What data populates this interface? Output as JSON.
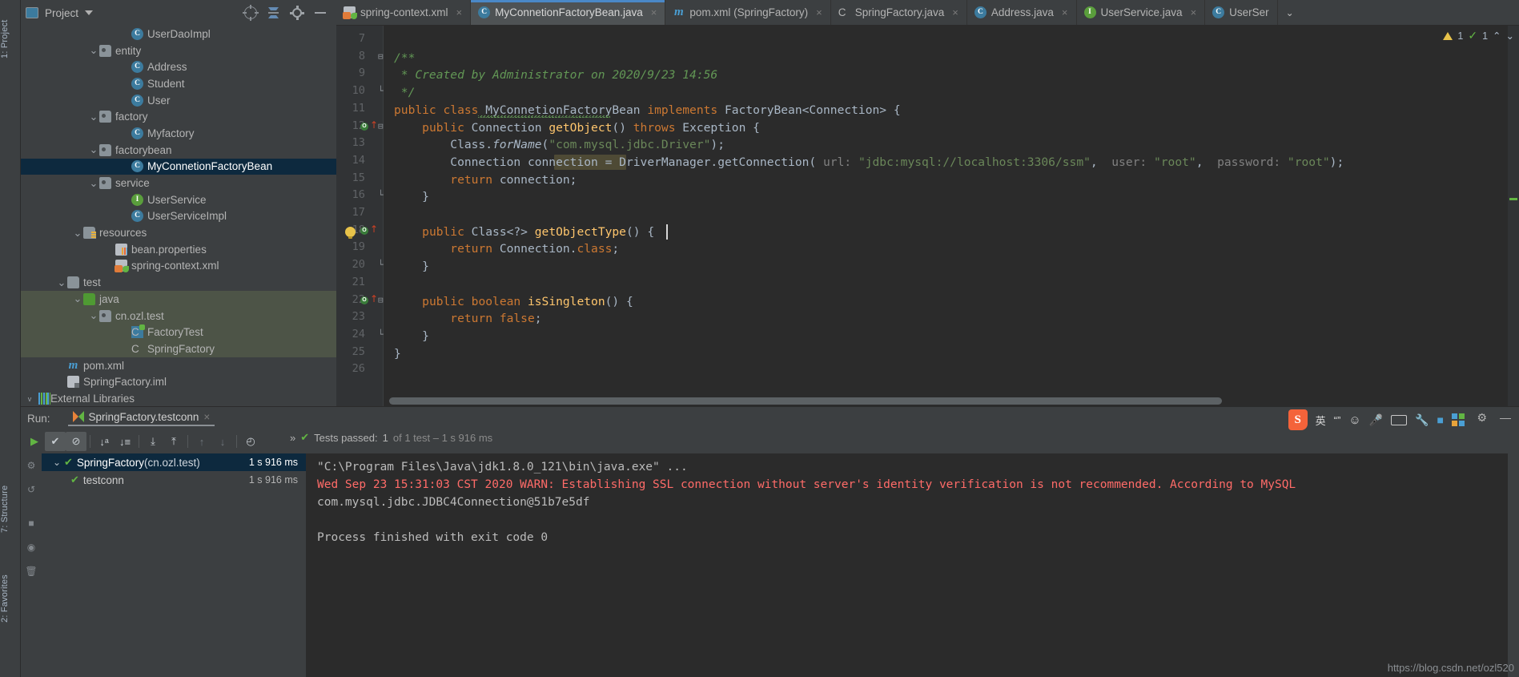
{
  "window": {
    "left_vertical_tabs": [
      {
        "label": "1: Project",
        "name": "project"
      },
      {
        "label": "7: Structure",
        "name": "structure"
      },
      {
        "label": "2: Favorites",
        "name": "favorites"
      }
    ]
  },
  "project_panel": {
    "title": "Project",
    "caret": "chevron-down",
    "tools": [
      "locate-icon",
      "collapse-all-icon",
      "settings-gear-icon",
      "hide-icon"
    ]
  },
  "tabs": [
    {
      "label": "spring-context.xml",
      "icon": "xml",
      "active": false,
      "close": "×"
    },
    {
      "label": "MyConnetionFactoryBean.java",
      "icon": "cls",
      "active": true,
      "close": "×"
    },
    {
      "label": "pom.xml (SpringFactory)",
      "icon": "m",
      "active": false,
      "close": "×"
    },
    {
      "label": "SpringFactory.java",
      "icon": "cls-run",
      "active": false,
      "close": "×"
    },
    {
      "label": "Address.java",
      "icon": "cls",
      "active": false,
      "close": "×"
    },
    {
      "label": "UserService.java",
      "icon": "iface",
      "active": false,
      "close": "×"
    },
    {
      "label": "UserSer",
      "icon": "cls",
      "active": false,
      "close": ""
    }
  ],
  "tabs_overflow_caret": "⌄",
  "inspection": {
    "warning_count": "1",
    "inspection_count": "1",
    "up_caret": "⌃",
    "down_caret": "⌄"
  },
  "tree": [
    {
      "label": "UserDaoImpl",
      "icon": "cls",
      "indent": 6,
      "arrow": "",
      "state": ""
    },
    {
      "label": "entity",
      "icon": "folder-pkg",
      "indent": 4,
      "arrow": "v",
      "state": ""
    },
    {
      "label": "Address",
      "icon": "cls",
      "indent": 6,
      "arrow": "",
      "state": ""
    },
    {
      "label": "Student",
      "icon": "cls",
      "indent": 6,
      "arrow": "",
      "state": ""
    },
    {
      "label": "User",
      "icon": "cls",
      "indent": 6,
      "arrow": "",
      "state": ""
    },
    {
      "label": "factory",
      "icon": "folder-pkg",
      "indent": 4,
      "arrow": "v",
      "state": ""
    },
    {
      "label": "Myfactory",
      "icon": "cls",
      "indent": 6,
      "arrow": "",
      "state": ""
    },
    {
      "label": "factorybean",
      "icon": "folder-pkg",
      "indent": 4,
      "arrow": "v",
      "state": ""
    },
    {
      "label": "MyConnetionFactoryBean",
      "icon": "cls",
      "indent": 6,
      "arrow": "",
      "state": "sel"
    },
    {
      "label": "service",
      "icon": "folder-pkg",
      "indent": 4,
      "arrow": "v",
      "state": ""
    },
    {
      "label": "UserService",
      "icon": "iface",
      "indent": 6,
      "arrow": "",
      "state": ""
    },
    {
      "label": "UserServiceImpl",
      "icon": "cls",
      "indent": 6,
      "arrow": "",
      "state": ""
    },
    {
      "label": "resources",
      "icon": "folder-res",
      "indent": 3,
      "arrow": "v",
      "state": ""
    },
    {
      "label": "bean.properties",
      "icon": "props",
      "indent": 5,
      "arrow": "",
      "state": ""
    },
    {
      "label": "spring-context.xml",
      "icon": "xml",
      "indent": 5,
      "arrow": "",
      "state": ""
    },
    {
      "label": "test",
      "icon": "folder",
      "indent": 2,
      "arrow": "v",
      "state": ""
    },
    {
      "label": "java",
      "icon": "folder-green",
      "indent": 3,
      "arrow": "v",
      "state": "testsrc"
    },
    {
      "label": "cn.ozl.test",
      "icon": "folder-pkg",
      "indent": 4,
      "arrow": "v",
      "state": "testsrc"
    },
    {
      "label": "FactoryTest",
      "icon": "cls-test",
      "indent": 6,
      "arrow": "",
      "state": "testsrc"
    },
    {
      "label": "SpringFactory",
      "icon": "cls-run",
      "indent": 6,
      "arrow": "",
      "state": "testsrc"
    },
    {
      "label": "pom.xml",
      "icon": "m",
      "indent": 2,
      "arrow": "",
      "state": ""
    },
    {
      "label": "SpringFactory.iml",
      "icon": "iml",
      "indent": 2,
      "arrow": "",
      "state": ""
    }
  ],
  "external_libraries": {
    "label": "External Libraries",
    "arrow": "v",
    "icon": "lib"
  },
  "editor": {
    "first_line_number": 7,
    "last_line_number": 26,
    "lines": [
      {
        "n": 7,
        "segments": []
      },
      {
        "n": 8,
        "segments": [
          {
            "t": "/**",
            "c": "cmt"
          }
        ],
        "indent": 0,
        "fold": "minus"
      },
      {
        "n": 9,
        "segments": [
          {
            "t": " * Created by Administrator on 2020/9/23 14:56",
            "c": "cmt"
          }
        ],
        "indent": 0
      },
      {
        "n": 10,
        "segments": [
          {
            "t": " */",
            "c": "cmt"
          }
        ],
        "indent": 0,
        "fold": "end"
      },
      {
        "n": 11,
        "segments": [
          {
            "t": "public ",
            "c": "kw"
          },
          {
            "t": "class ",
            "c": "kw"
          },
          {
            "t": "MyConnetionFactoryBean ",
            "c": "plain"
          },
          {
            "t": "implements ",
            "c": "kw"
          },
          {
            "t": "FactoryBean<Connection> {",
            "c": "plain"
          }
        ]
      },
      {
        "n": 12,
        "segments": [
          {
            "t": "    ",
            "c": "plain"
          },
          {
            "t": "public ",
            "c": "kw"
          },
          {
            "t": "Connection ",
            "c": "plain"
          },
          {
            "t": "getObject",
            "c": "fn"
          },
          {
            "t": "() ",
            "c": "plain"
          },
          {
            "t": "throws ",
            "c": "kw"
          },
          {
            "t": "Exception {",
            "c": "plain"
          }
        ],
        "marker": "override",
        "fold": "minus"
      },
      {
        "n": 13,
        "segments": [
          {
            "t": "        Class.",
            "c": "plain"
          },
          {
            "t": "forName",
            "c": "static-it"
          },
          {
            "t": "(",
            "c": "plain"
          },
          {
            "t": "\"com.mysql.jdbc.Driver\"",
            "c": "str"
          },
          {
            "t": ");",
            "c": "plain"
          }
        ]
      },
      {
        "n": 14,
        "segments": [
          {
            "t": "        Connection ",
            "c": "plain"
          },
          {
            "t": "connection",
            "c": "plain"
          },
          {
            "t": " = DriverManager.",
            "c": "plain"
          },
          {
            "t": "getConnection",
            "c": "plain"
          },
          {
            "t": "( ",
            "c": "plain"
          },
          {
            "t": "url:",
            "c": "param-hint"
          },
          {
            "t": " \"jdbc:mysql://localhost:3306/ssm\"",
            "c": "str"
          },
          {
            "t": ",  ",
            "c": "plain"
          },
          {
            "t": "user:",
            "c": "param-hint"
          },
          {
            "t": " \"root\"",
            "c": "str"
          },
          {
            "t": ",  ",
            "c": "plain"
          },
          {
            "t": "password:",
            "c": "param-hint"
          },
          {
            "t": " \"root\"",
            "c": "str"
          },
          {
            "t": ");",
            "c": "plain"
          }
        ]
      },
      {
        "n": 15,
        "segments": [
          {
            "t": "        ",
            "c": "plain"
          },
          {
            "t": "return ",
            "c": "kw"
          },
          {
            "t": "connection;",
            "c": "plain"
          }
        ]
      },
      {
        "n": 16,
        "segments": [
          {
            "t": "    }",
            "c": "plain"
          }
        ],
        "fold": "end"
      },
      {
        "n": 17,
        "segments": []
      },
      {
        "n": 18,
        "segments": [
          {
            "t": "    ",
            "c": "plain"
          },
          {
            "t": "public ",
            "c": "kw"
          },
          {
            "t": "Class<?> ",
            "c": "plain"
          },
          {
            "t": "getObjectType",
            "c": "fn"
          },
          {
            "t": "() ",
            "c": "plain"
          },
          {
            "t": "{",
            "c": "plain"
          }
        ],
        "marker": "override",
        "bulb": true,
        "caret": true
      },
      {
        "n": 19,
        "segments": [
          {
            "t": "        ",
            "c": "plain"
          },
          {
            "t": "return ",
            "c": "kw"
          },
          {
            "t": "Connection.",
            "c": "plain"
          },
          {
            "t": "class",
            "c": "kw"
          },
          {
            "t": ";",
            "c": "plain"
          }
        ]
      },
      {
        "n": 20,
        "segments": [
          {
            "t": "    }",
            "c": "plain"
          }
        ],
        "fold": "end",
        "brace_match": true
      },
      {
        "n": 21,
        "segments": []
      },
      {
        "n": 22,
        "segments": [
          {
            "t": "    ",
            "c": "plain"
          },
          {
            "t": "public ",
            "c": "kw"
          },
          {
            "t": "boolean ",
            "c": "kw"
          },
          {
            "t": "isSingleton",
            "c": "fn"
          },
          {
            "t": "() {",
            "c": "plain"
          }
        ],
        "marker": "override",
        "fold": "minus"
      },
      {
        "n": 23,
        "segments": [
          {
            "t": "        ",
            "c": "plain"
          },
          {
            "t": "return ",
            "c": "kw"
          },
          {
            "t": "false",
            "c": "kw"
          },
          {
            "t": ";",
            "c": "plain"
          }
        ]
      },
      {
        "n": 24,
        "segments": [
          {
            "t": "    }",
            "c": "plain"
          }
        ],
        "fold": "end"
      },
      {
        "n": 25,
        "segments": [
          {
            "t": "}",
            "c": "plain"
          }
        ]
      },
      {
        "n": 26,
        "segments": []
      }
    ]
  },
  "run_panel": {
    "run_label": "Run:",
    "tab_label": "SpringFactory.testconn",
    "tab_close": "×",
    "toolbar": [
      {
        "name": "rerun-button",
        "glyph": "▶",
        "pressed": false,
        "color": "#62b543"
      },
      {
        "name": "show-passed-toggle",
        "glyph": "✔",
        "pressed": true,
        "color": "#c7cdd2"
      },
      {
        "name": "show-ignored-toggle",
        "glyph": "⊘",
        "pressed": true,
        "color": "#c7cdd2"
      },
      {
        "name": "sort-alphabetically-button",
        "glyph": "↓ᵃ",
        "pressed": false,
        "color": "#c7cdd2"
      },
      {
        "name": "sort-by-duration-button",
        "glyph": "↓≡",
        "pressed": false,
        "color": "#c7cdd2"
      },
      {
        "name": "expand-all-button",
        "glyph": "⤓",
        "pressed": false,
        "color": "#c7cdd2"
      },
      {
        "name": "collapse-all-button",
        "glyph": "⤒",
        "pressed": false,
        "color": "#c7cdd2"
      },
      {
        "name": "previous-failed-button",
        "glyph": "↑",
        "pressed": false,
        "color": "#6f767b"
      },
      {
        "name": "next-failed-button",
        "glyph": "↓",
        "pressed": false,
        "color": "#6f767b"
      },
      {
        "name": "test-history-button",
        "glyph": "◴",
        "pressed": false,
        "color": "#c7cdd2"
      }
    ],
    "overflow_chevrons": "»",
    "status": {
      "check": "✔",
      "text": "Tests passed: ",
      "count": "1",
      "detail": " of 1 test – 1 s 916 ms"
    },
    "test_tree": [
      {
        "label": "SpringFactory",
        "pkg": " (cn.ozl.test)",
        "time": "1 s 916 ms",
        "arrow": "v",
        "sel": true,
        "indent": 0
      },
      {
        "label": "testconn",
        "pkg": "",
        "time": "1 s 916 ms",
        "arrow": "",
        "sel": false,
        "indent": 1
      }
    ],
    "console": [
      {
        "text": "\"C:\\Program Files\\Java\\jdk1.8.0_121\\bin\\java.exe\" ...",
        "cls": "c-cmd"
      },
      {
        "text": "Wed Sep 23 15:31:03 CST 2020 WARN: Establishing SSL connection without server's identity verification is not recommended. According to MySQL",
        "cls": "c-warn"
      },
      {
        "text": "com.mysql.jdbc.JDBC4Connection@51b7e5df",
        "cls": "c-out"
      },
      {
        "text": "",
        "cls": "c-out"
      },
      {
        "text": "Process finished with exit code 0",
        "cls": "c-out"
      }
    ]
  },
  "ime_bar": {
    "logo": "S",
    "items": [
      {
        "name": "ime-lang-label",
        "glyph": "英"
      },
      {
        "name": "ime-punct-icon",
        "glyph": "“”"
      },
      {
        "name": "ime-emoji-icon",
        "glyph": "☺"
      },
      {
        "name": "ime-mic-icon",
        "glyph": "Ἲ4"
      },
      {
        "name": "ime-keyboard-icon",
        "glyph": ""
      },
      {
        "name": "ime-tools-icon",
        "glyph": ""
      },
      {
        "name": "ime-box-icon",
        "glyph": ""
      },
      {
        "name": "ime-grid-icon",
        "glyph": ""
      }
    ]
  },
  "window_controls": [
    {
      "name": "settings-gear-icon",
      "glyph": "⚙"
    },
    {
      "name": "hide-panel-icon",
      "glyph": "—"
    }
  ],
  "watermark": "https://blog.csdn.net/ozl520",
  "colors": {
    "accent_blue": "#4a88c7",
    "selection_blue": "#0d293e",
    "test_source_green": "#4d5447",
    "editor_bg": "#2b2b2b",
    "panel_bg": "#3c3f41",
    "keyword_orange": "#cc7832",
    "string_green": "#6a8759",
    "comment_green": "#629755",
    "method_yellow": "#ffc66d",
    "error_red": "#ff6b68",
    "pass_green": "#62b543"
  }
}
